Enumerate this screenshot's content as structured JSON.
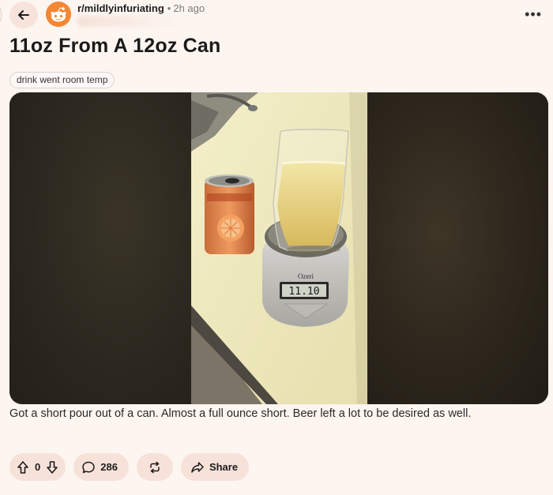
{
  "header": {
    "subreddit": "r/mildlyinfuriating",
    "separator": "•",
    "time_ago": "2h ago",
    "more_label": "•••"
  },
  "post": {
    "title": "11oz From A 12oz Can",
    "flair": "drink went room temp",
    "body": "Got a short pour out of a can. Almost a full ounce short. Beer left a lot to be desired as well.",
    "scale_reading": "11.10",
    "scale_brand": "Ozeri"
  },
  "actions": {
    "vote_count": "0",
    "comment_count": "286",
    "share_label": "Share"
  },
  "icons": {
    "back": "arrow-left-icon",
    "avatar": "snoo-avatar",
    "upvote": "arrow-up-icon",
    "downvote": "arrow-down-icon",
    "comments": "speech-bubble-icon",
    "repost": "repost-icon",
    "share": "share-arrow-icon",
    "more": "more-dots-icon"
  },
  "colors": {
    "page_background": "#fdf5f0",
    "pill_background": "#f7e2da",
    "avatar_orange": "#f58634"
  }
}
